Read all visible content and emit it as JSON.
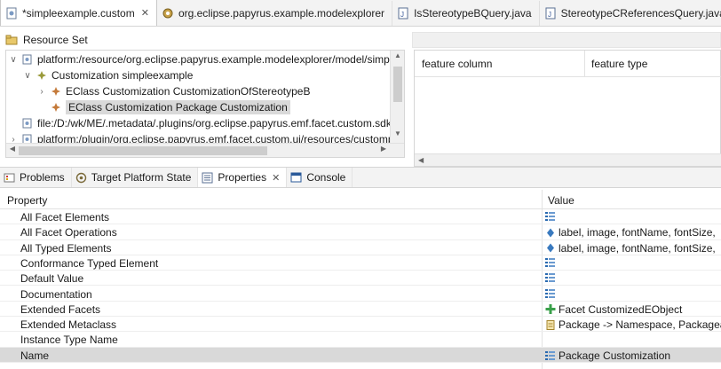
{
  "editor_tabs": [
    {
      "label": "*simpleexample.custom",
      "icon": "custom-file-icon",
      "active": true,
      "closable": true
    },
    {
      "label": "org.eclipse.papyrus.example.modelexplorer",
      "icon": "plugin-icon",
      "active": false,
      "closable": false
    },
    {
      "label": "IsStereotypeBQuery.java",
      "icon": "java-file-icon",
      "active": false,
      "closable": false
    },
    {
      "label": "StereotypeCReferencesQuery.java",
      "icon": "java-file-icon",
      "active": false,
      "closable": false
    }
  ],
  "resource_set": {
    "title": "Resource Set",
    "tree": [
      {
        "label": "platform:/resource/org.eclipse.papyrus.example.modelexplorer/model/simple",
        "icon": "resource-icon",
        "expander": "v",
        "indent": 0
      },
      {
        "label": "Customization simpleexample",
        "icon": "customization-icon",
        "expander": "v",
        "indent": 1
      },
      {
        "label": "EClass Customization CustomizationOfStereotypeB",
        "icon": "eclass-customization-icon",
        "expander": ">",
        "indent": 2
      },
      {
        "label": "EClass Customization Package Customization",
        "icon": "eclass-customization-icon",
        "expander": "",
        "indent": 2,
        "selected": true
      },
      {
        "label": "file:/D:/wk/ME/.metadata/.plugins/org.eclipse.papyrus.emf.facet.custom.sdk.",
        "icon": "resource-icon",
        "expander": "",
        "indent": 0
      },
      {
        "label": "platform:/plugin/org.eclipse.papyrus.emf.facet.custom.ui/resources/customp",
        "icon": "resource-icon",
        "expander": ">",
        "indent": 0
      }
    ]
  },
  "feature_table": {
    "col1": "feature column",
    "col2": "feature type"
  },
  "view_tabs": [
    {
      "label": "Problems",
      "icon": "problems-icon",
      "active": false
    },
    {
      "label": "Target Platform State",
      "icon": "target-platform-icon",
      "active": false
    },
    {
      "label": "Properties",
      "icon": "properties-icon",
      "active": true
    },
    {
      "label": "Console",
      "icon": "console-icon",
      "active": false
    }
  ],
  "properties": {
    "header_property": "Property",
    "header_value": "Value",
    "rows": [
      {
        "name": "All Facet Elements",
        "value": "",
        "value_icon": "list-icon"
      },
      {
        "name": "All Facet Operations",
        "value": "label,  image,  fontName,  fontSize,",
        "value_icon": "operation-icon"
      },
      {
        "name": "All Typed Elements",
        "value": "label,  image,  fontName,  fontSize,",
        "value_icon": "operation-icon"
      },
      {
        "name": "Conformance Typed Element",
        "value": "",
        "value_icon": "list-icon"
      },
      {
        "name": "Default Value",
        "value": "",
        "value_icon": "list-icon"
      },
      {
        "name": "Documentation",
        "value": "",
        "value_icon": "list-icon"
      },
      {
        "name": "Extended Facets",
        "value": "Facet CustomizedEObject",
        "value_icon": "facet-icon"
      },
      {
        "name": "Extended Metaclass",
        "value": "Package -> Namespace, Packageabl",
        "value_icon": "metaclass-icon"
      },
      {
        "name": "Instance Type Name",
        "value": "",
        "value_icon": ""
      },
      {
        "name": "Name",
        "value": "Package Customization",
        "value_icon": "list-icon",
        "selected": true
      }
    ]
  },
  "colors": {
    "selection": "#d9d9d9",
    "tab_bar": "#f3f3f3",
    "border": "#d5d5d5"
  }
}
